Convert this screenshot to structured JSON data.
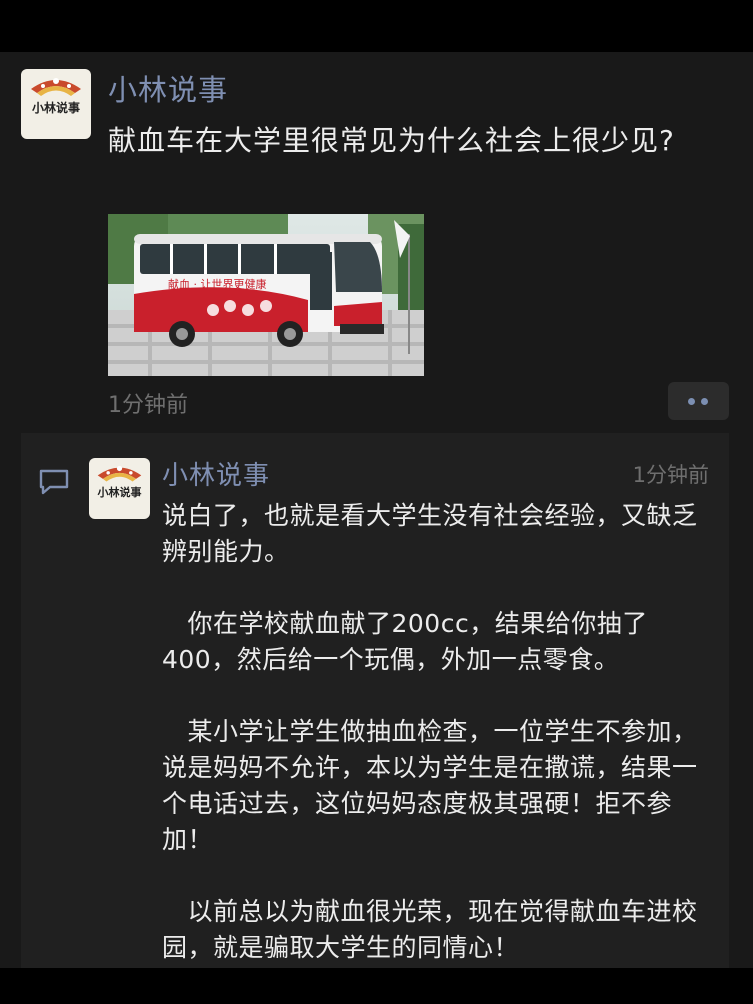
{
  "post": {
    "author": "小林说事",
    "avatar_text": "小林说事",
    "text": "献血车在大学里很常见为什么社会上很少见?",
    "image": {
      "bus_slogan": "献血 · 让世界更健康"
    },
    "time": "1分钟前"
  },
  "more_button": {
    "icon": "two-dots-icon"
  },
  "comment": {
    "icon": "comment-icon",
    "author": "小林说事",
    "avatar_text": "小林说事",
    "time": "1分钟前",
    "paragraphs": [
      "说白了，也就是看大学生没有社会经验，又缺乏辨别能力。",
      "　你在学校献血献了200cc，结果给你抽了400，然后给一个玩偶，外加一点零食。",
      "　某小学让学生做抽血检查，一位学生不参加，说是妈妈不允许，本以为学生是在撒谎，结果一个电话过去，这位妈妈态度极其强硬！拒不参加！",
      "　以前总以为献血很光荣，现在觉得献血车进校园，就是骗取大学生的同情心！"
    ]
  },
  "colors": {
    "background": "#191919",
    "name_blue": "#7f8fb2",
    "text": "#ececec",
    "muted": "#6f6f6f",
    "comment_bg": "#202020",
    "bus_red": "#c9202c"
  }
}
